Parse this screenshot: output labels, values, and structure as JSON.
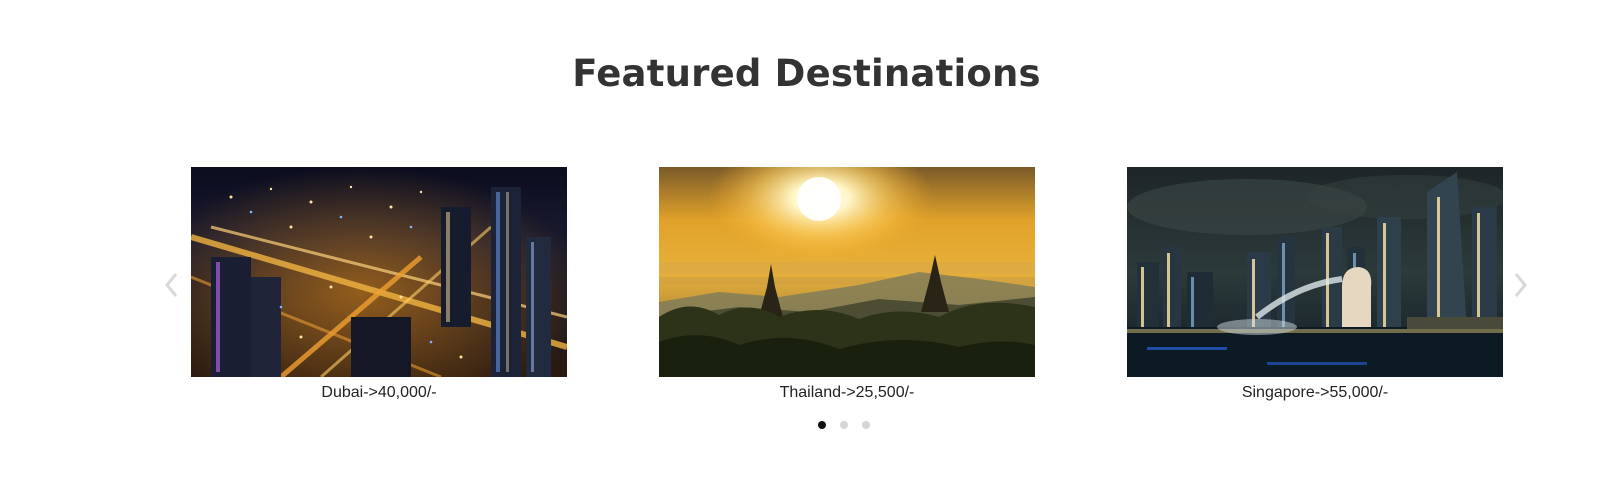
{
  "section": {
    "title": "Featured Destinations"
  },
  "destinations": [
    {
      "caption": "Dubai->40,000/-",
      "image": "dubai-night-city-photo"
    },
    {
      "caption": "Thailand->25,500/-",
      "image": "thailand-sunset-temples-photo"
    },
    {
      "caption": "Singapore->55,000/-",
      "image": "singapore-merlion-night-photo"
    }
  ],
  "carousel": {
    "prev_icon": "chevron-left-icon",
    "next_icon": "chevron-right-icon",
    "page_count": 3,
    "active_page": 1
  },
  "colors": {
    "heading": "#333333",
    "caption": "#222222",
    "dot_active": "#111111",
    "dot_inactive": "#d6d6d6",
    "arrow": "#d9d9d9"
  }
}
